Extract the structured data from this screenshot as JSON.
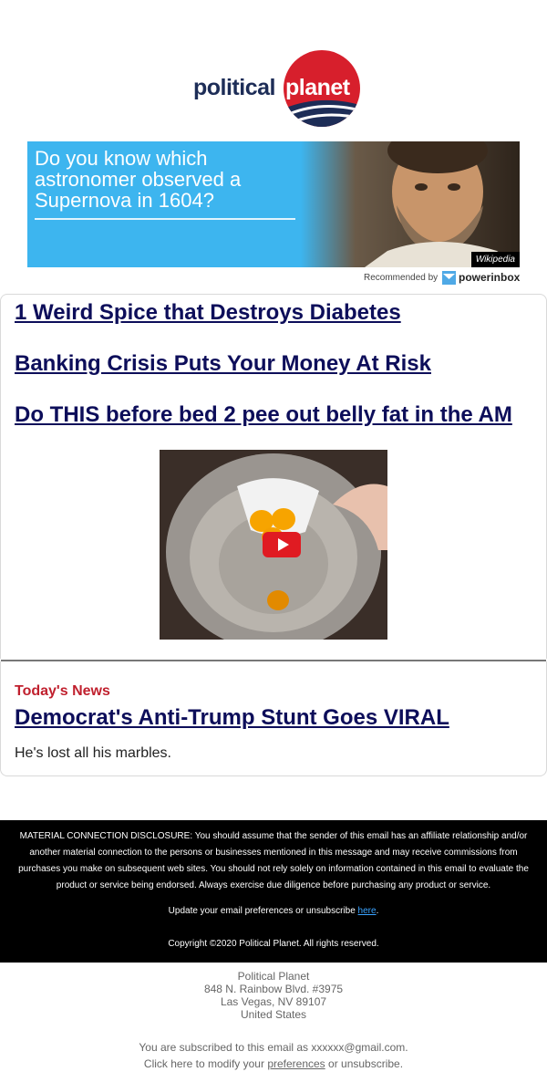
{
  "logo": {
    "word1": "political",
    "word2": "planet",
    "colors": {
      "navy": "#1d2d57",
      "red": "#d71f2c"
    }
  },
  "ad": {
    "text": "Do you know which astronomer observed a Supernova in 1604?",
    "credit": "Wikipedia",
    "background": "#3db5ef",
    "recommended_label": "Recommended by",
    "recommended_brand": "powerinbox"
  },
  "headlines": [
    "1 Weird Spice that Destroys Diabetes",
    "Banking Crisis Puts Your Money At Risk",
    "Do THIS before bed 2 pee out belly fat in the AM"
  ],
  "video": {
    "icon": "play-icon"
  },
  "todays_news": {
    "label": "Today's News",
    "title": "Democrat's Anti-Trump Stunt Goes VIRAL",
    "teaser": "He's lost all his marbles."
  },
  "footer": {
    "disclosure": "MATERIAL CONNECTION DISCLOSURE: You should assume that the sender of this email has an affiliate relationship and/or another material connection to the persons or businesses mentioned in this message and may receive commissions from purchases you make on subsequent web sites. You should not rely solely on information contained in this email to evaluate the product or service being endorsed. Always exercise due diligence before purchasing any product or service.",
    "update_prefix": "Update your email preferences or unsubscribe ",
    "update_link": "here",
    "update_suffix": ".",
    "copyright": "Copyright ©2020 Political Planet. All rights reserved."
  },
  "address": {
    "company": "Political Planet",
    "street": "848 N. Rainbow Blvd. #3975",
    "city": "Las Vegas, NV 89107",
    "country": "United States"
  },
  "subscription": {
    "line1": "You are subscribed to this email as xxxxxx@gmail.com.",
    "line2_prefix": "Click here to modify your ",
    "line2_link": "preferences",
    "line2_suffix": " or unsubscribe."
  }
}
